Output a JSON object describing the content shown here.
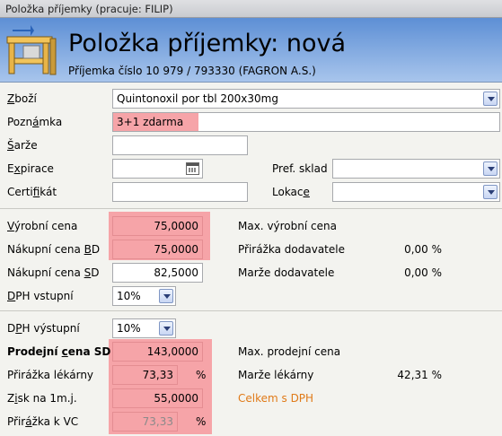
{
  "window": {
    "title": "Položka příjemky (pracuje: FILIP)"
  },
  "header": {
    "title": "Položka příjemky: nová",
    "subtitle": "Příjemka číslo 10 979 / 793330 (FAGRON A.S.)",
    "icon": "shelf-icon"
  },
  "colors": {
    "highlight": "#f6a4a8",
    "header_blue": "#5d8fd5",
    "orange_text": "#e07a18"
  },
  "form": {
    "zbozi": {
      "label_pre": "",
      "label_ul": "Z",
      "label_post": "boží",
      "value": "Quintonoxil por tbl 200x30mg"
    },
    "poznamka": {
      "label_pre": "Pozn",
      "label_ul": "á",
      "label_post": "mka",
      "value": "3+1 zdarma"
    },
    "sarze": {
      "label_pre": "",
      "label_ul": "Š",
      "label_post": "arže",
      "value": ""
    },
    "expirace": {
      "label_pre": "E",
      "label_ul": "x",
      "label_post": "pirace",
      "value": ""
    },
    "certifikat": {
      "label_pre": "Certi",
      "label_ul": "f",
      "label_post": "ikát",
      "value": ""
    },
    "pref_sklad": {
      "label": "Pref. sklad",
      "value": ""
    },
    "lokace": {
      "label_pre": "Lokac",
      "label_ul": "e",
      "label_post": "",
      "value": ""
    }
  },
  "prices": {
    "vyrobni": {
      "label_pre": "",
      "label_ul": "V",
      "label_post": "ýrobní cena",
      "value": "75,0000"
    },
    "nakupni_bd": {
      "label_pre": "Nákupní cena ",
      "label_ul": "B",
      "label_post": "D",
      "value": "75,0000"
    },
    "nakupni_sd": {
      "label_pre": "Nákupní cena ",
      "label_ul": "S",
      "label_post": "D",
      "value": "82,5000"
    },
    "dph_vstupni": {
      "label_pre": "",
      "label_ul": "D",
      "label_post": "PH vstupní",
      "value": "10%"
    },
    "max_vyrobni": {
      "label": "Max. výrobní cena",
      "value": ""
    },
    "prirazka_dod": {
      "label": "Přirážka dodavatele",
      "value": "0,00 %"
    },
    "marze_dod": {
      "label": "Marže dodavatele",
      "value": "0,00 %"
    }
  },
  "sales": {
    "dph_vystupni": {
      "label_pre": "D",
      "label_ul": "P",
      "label_post": "H výstupní",
      "value": "10%"
    },
    "prodejni_sd": {
      "label_pre": "Prodejní ",
      "label_ul": "c",
      "label_post": "ena SD",
      "value": "143,0000"
    },
    "prirazka_lek": {
      "label": "Přirážka lékárny",
      "value": "73,33",
      "unit": "%"
    },
    "zisk": {
      "label_pre": "Z",
      "label_ul": "i",
      "label_post": "sk na 1m.j.",
      "value": "55,0000"
    },
    "prirazka_vc": {
      "label_pre": "Přir",
      "label_ul": "á",
      "label_post": "žka k VC",
      "value": "73,33",
      "unit": "%"
    },
    "max_prodejni": {
      "label": "Max. prodejní cena",
      "value": ""
    },
    "marze_lek": {
      "label": "Marže lékárny",
      "value": "42,31 %"
    },
    "celkem_dph": {
      "label": "Celkem s DPH"
    }
  }
}
